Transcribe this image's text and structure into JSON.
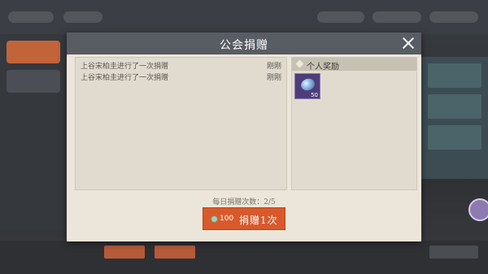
{
  "dialog": {
    "title": "公会捐赠",
    "close_icon": "close-icon"
  },
  "log": {
    "entries": [
      {
        "text": "上谷宋柏圭进行了一次捐赠",
        "time": "刚刚"
      },
      {
        "text": "上谷宋柏圭进行了一次捐赠",
        "time": "刚刚"
      }
    ]
  },
  "rewards": {
    "header": "个人奖励",
    "items": [
      {
        "icon": "gem-icon",
        "count": "50"
      }
    ]
  },
  "donation": {
    "counter_text": "每日捐赠次数：2/5",
    "cost": "100",
    "cost_icon": "coin-icon",
    "button_label": "捐赠1次"
  },
  "colors": {
    "header": "#585c63",
    "panel": "#ece6da",
    "donate_button": "#d85a2c"
  }
}
